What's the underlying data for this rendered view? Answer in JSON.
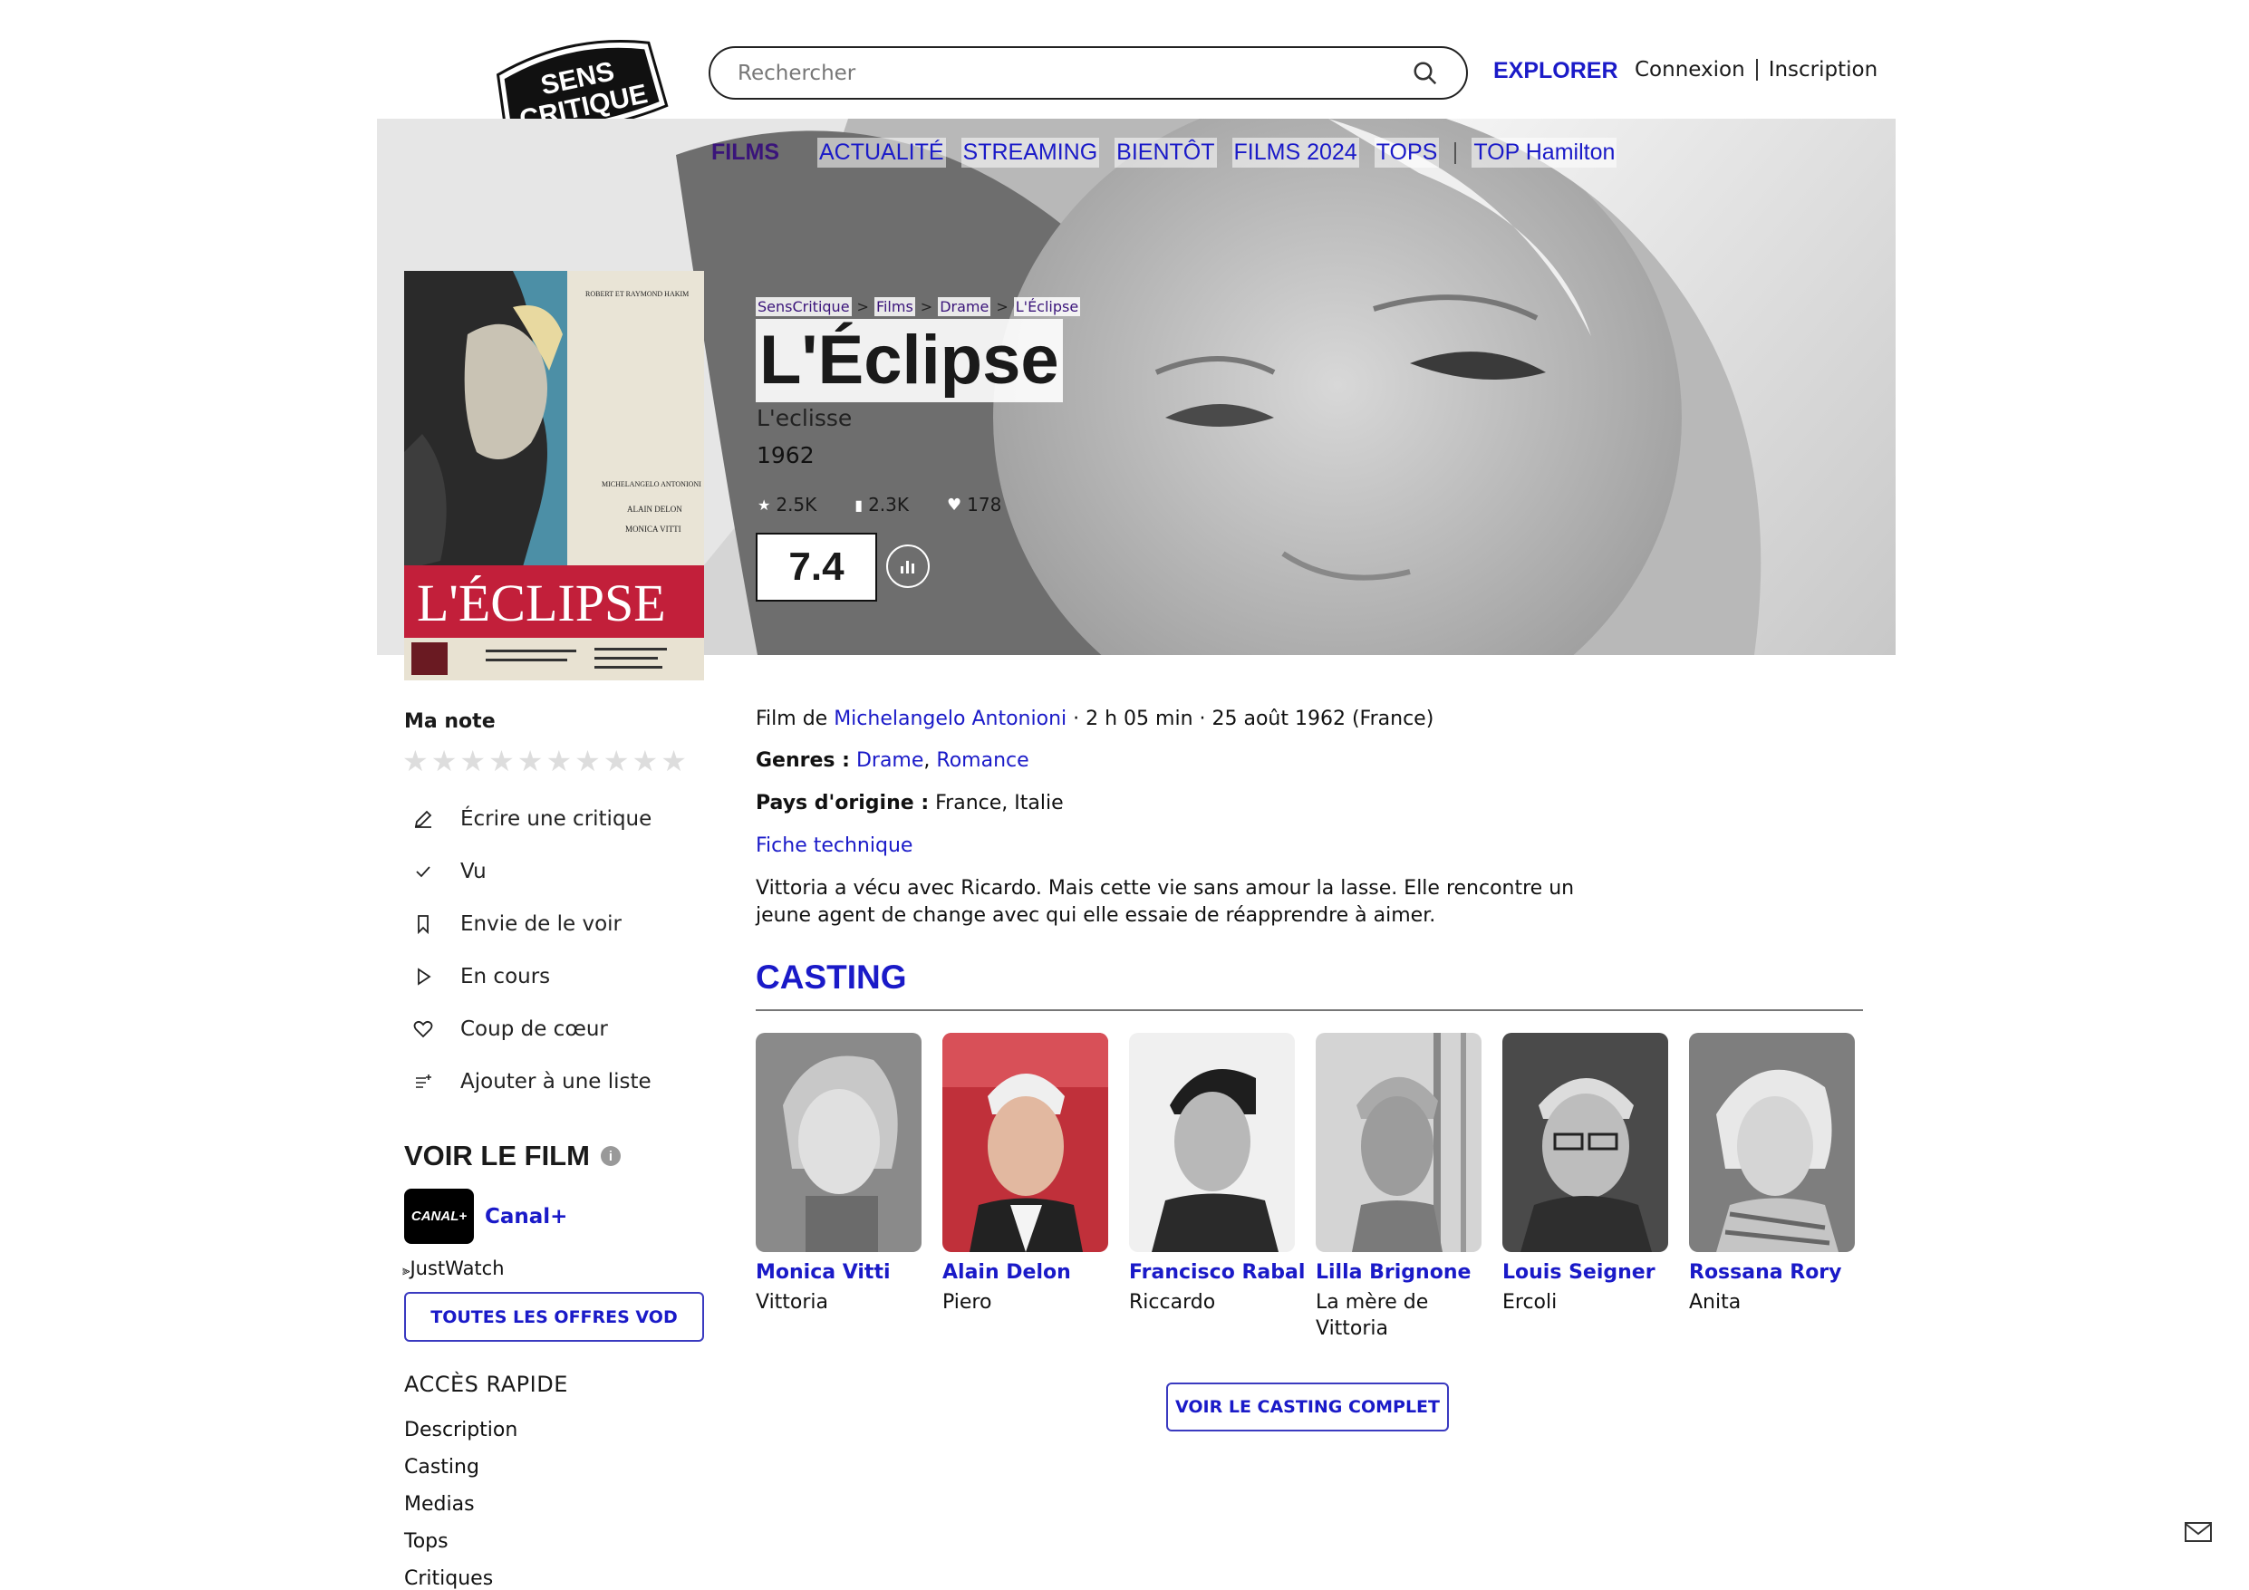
{
  "header": {
    "logo_text": [
      "SENS",
      "CRITIQUE"
    ],
    "search_placeholder": "Rechercher",
    "explorer": "EXPLORER",
    "login": "Connexion",
    "signup": "Inscription"
  },
  "nav": {
    "films": "FILMS",
    "items": [
      "ACTUALITÉ",
      "STREAMING",
      "BIENTÔT",
      "FILMS 2024",
      "TOPS"
    ],
    "extra": "TOP Hamilton"
  },
  "breadcrumb": [
    "SensCritique",
    "Films",
    "Drame",
    "L'Éclipse"
  ],
  "movie": {
    "title": "L'Éclipse",
    "original_title": "L'eclisse",
    "year": "1962",
    "stats": {
      "ratings": "2.5K",
      "wishlist": "2.3K",
      "favorites": "178"
    },
    "rating": "7.4",
    "poster": {
      "producers": "ROBERT ET RAYMOND HAKIM",
      "director": "MICHELANGELO ANTONIONI",
      "actors": [
        "ALAIN DELON",
        "MONICA VITTI"
      ],
      "title": "L'ÉCLIPSE"
    },
    "film_by_label": "Film de",
    "director": "Michelangelo Antonioni",
    "details": "· 2 h 05 min · 25 août 1962 (France)",
    "genres_label": "Genres :",
    "genres": [
      "Drame",
      "Romance"
    ],
    "countries_label": "Pays d'origine :",
    "countries": "France, Italie",
    "fiche": "Fiche technique",
    "synopsis": "Vittoria a vécu avec Ricardo. Mais cette vie sans amour la lasse. Elle rencontre un jeune agent de change avec qui elle essaie de réapprendre à aimer."
  },
  "sidebar": {
    "my_rating": "Ma note",
    "stars_count": 10,
    "actions": [
      {
        "label": "Écrire une critique",
        "icon": "pencil-icon"
      },
      {
        "label": "Vu",
        "icon": "check-icon"
      },
      {
        "label": "Envie de le voir",
        "icon": "bookmark-icon"
      },
      {
        "label": "En cours",
        "icon": "play-icon"
      },
      {
        "label": "Coup de cœur",
        "icon": "heart-icon"
      },
      {
        "label": "Ajouter à une liste",
        "icon": "list-add-icon"
      }
    ],
    "watch_title": "VOIR LE FILM",
    "provider_logo": "CANAL+",
    "provider": "Canal+",
    "justwatch": "JustWatch",
    "vod_button": "TOUTES LES OFFRES VOD",
    "quick_title": "ACCÈS RAPIDE",
    "quick_links": [
      "Description",
      "Casting",
      "Medias",
      "Tops",
      "Critiques"
    ]
  },
  "casting": {
    "title": "CASTING",
    "actors": [
      {
        "name": "Monica Vitti",
        "role": "Vittoria"
      },
      {
        "name": "Alain Delon",
        "role": "Piero"
      },
      {
        "name": "Francisco Rabal",
        "role": "Riccardo"
      },
      {
        "name": "Lilla Brignone",
        "role": "La mère de Vittoria"
      },
      {
        "name": "Louis Seigner",
        "role": "Ercoli"
      },
      {
        "name": "Rossana Rory",
        "role": "Anita"
      }
    ],
    "full_button": "VOIR LE CASTING COMPLET"
  },
  "colors": {
    "accent": "#1a1ac8",
    "nav_active": "#3a147a"
  }
}
